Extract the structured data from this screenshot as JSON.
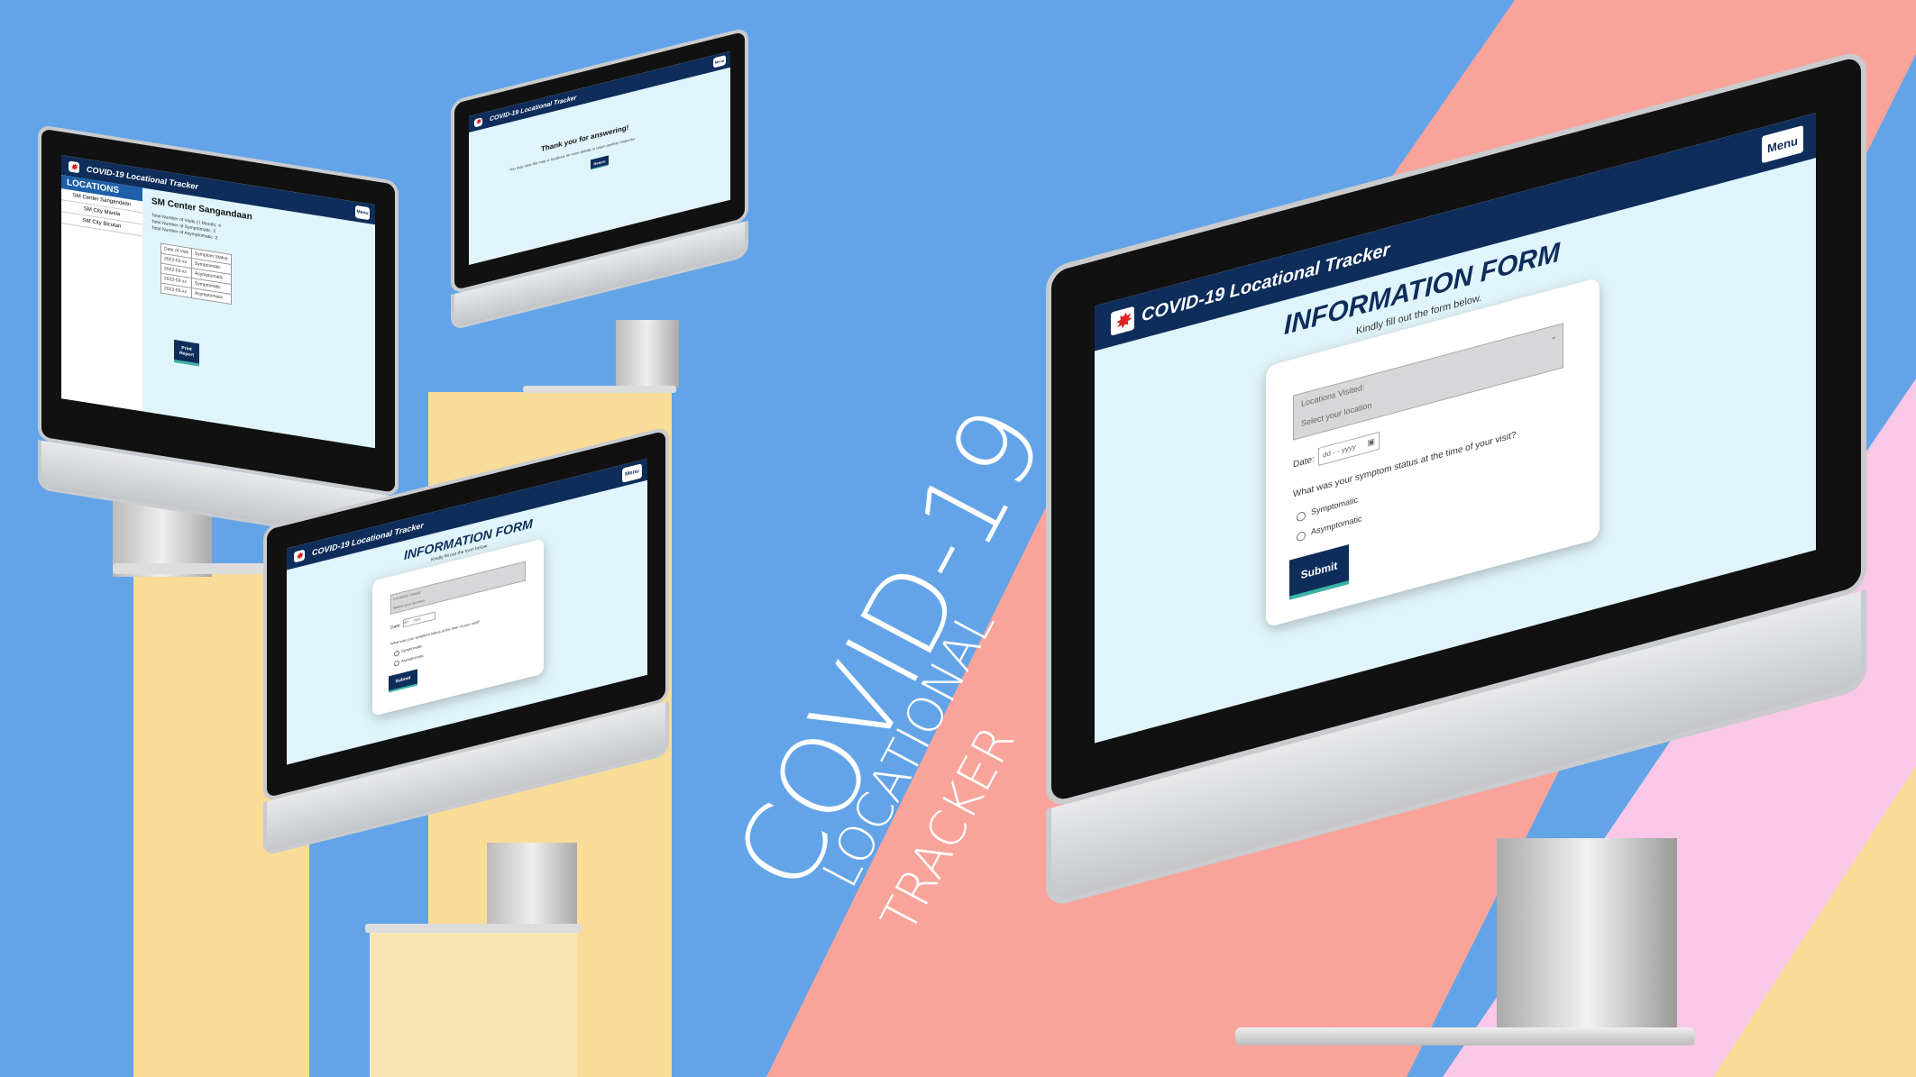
{
  "app": {
    "title": "COVID-19 Locational Tracker",
    "menu_label": "Menu"
  },
  "decorative_title": {
    "line1": "COVID-19",
    "line2": "LOCATIONAL",
    "line3": "TRACKER"
  },
  "info_form": {
    "heading": "INFORMATION FORM",
    "subheading": "Kindly fill out the form below.",
    "locations_label": "Locations Visited:",
    "locations_placeholder": "Select your location",
    "date_label": "Date:",
    "date_placeholder": "dd - - yyyy",
    "question": "What was your symptom status at the time of your visit?",
    "options": [
      "Symptomatic",
      "Asymptomatic"
    ],
    "submit_label": "Submit"
  },
  "thank_you": {
    "heading": "Thank you for answering!",
    "body": "You may view the map or locations for more details or return another response.",
    "button_label": "Return"
  },
  "locations_report": {
    "sidebar_title": "LOCATIONS",
    "sidebar_items": [
      "SM Center Sangandaan",
      "SM City Manila",
      "SM City Bicutan"
    ],
    "location_name": "SM Center Sangandaan",
    "stats": [
      "Total Number of Visits (1 Month): 4",
      "Total Number of Symptomatic: 2",
      "Total Number of Asymptomatic: 2"
    ],
    "table_headers": [
      "Date of Visit",
      "Symptom Status"
    ],
    "table_rows": [
      [
        "2022-03-xx",
        "Symptomatic"
      ],
      [
        "2022-03-xx",
        "Asymptomatic"
      ],
      [
        "2022-03-xx",
        "Symptomatic"
      ],
      [
        "2022-03-xx",
        "Asymptomatic"
      ]
    ],
    "print_label": "Print Report"
  },
  "colors": {
    "background": "#63a4e8",
    "salmon": "#f8a49b",
    "pink": "#f9c8e6",
    "yellow": "#f9dc98",
    "navy": "#0e2d5a",
    "screen": "#e0f5fb"
  }
}
